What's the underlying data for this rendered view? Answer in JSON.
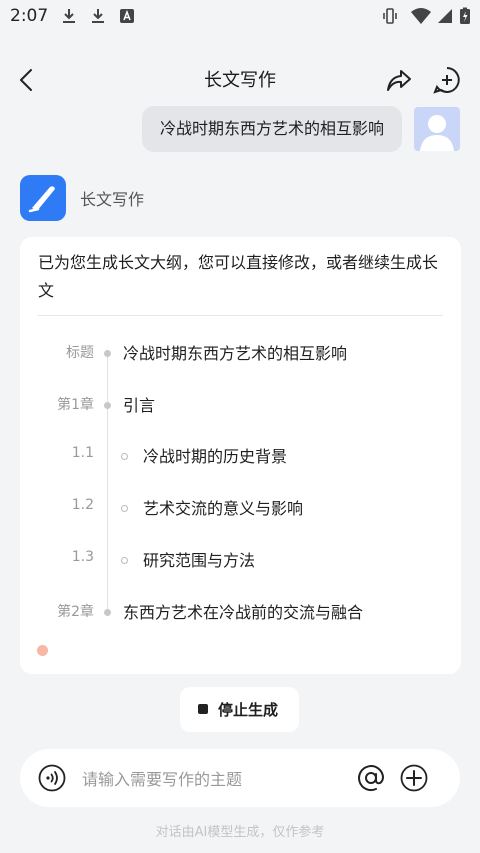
{
  "status_bar": {
    "time": "2:07",
    "icons": [
      "download-icon",
      "download-icon",
      "a-icon",
      "vibrate-icon",
      "wifi-icon",
      "signal-icon",
      "battery-charging-icon"
    ]
  },
  "header": {
    "title": "长文写作",
    "back_icon": "back-icon",
    "share_icon": "share-icon",
    "new_chat_icon": "new-chat-icon"
  },
  "user_message": {
    "text": "冷战时期东西方艺术的相互影响"
  },
  "bot": {
    "name": "长文写作",
    "intro": "已为您生成长文大纲，您可以直接修改，或者继续生成长文",
    "outline": [
      {
        "label": "标题",
        "text": "冷战时期东西方艺术的相互影响",
        "level": 0
      },
      {
        "label": "第1章",
        "text": "引言",
        "level": 0
      },
      {
        "label": "1.1",
        "text": "冷战时期的历史背景",
        "level": 1
      },
      {
        "label": "1.2",
        "text": "艺术交流的意义与影响",
        "level": 1
      },
      {
        "label": "1.3",
        "text": "研究范围与方法",
        "level": 1
      },
      {
        "label": "第2章",
        "text": "东西方艺术在冷战前的交流与融合",
        "level": 0
      }
    ]
  },
  "stop_button": {
    "label": "停止生成"
  },
  "input": {
    "placeholder": "请输入需要写作的主题"
  },
  "footer": {
    "note": "对话由AI模型生成，仅作参考"
  },
  "colors": {
    "accent": "#2f7bf6",
    "background": "#f3f4f6",
    "bubble": "#e4e5e8",
    "loading": "#f7b7a3"
  }
}
